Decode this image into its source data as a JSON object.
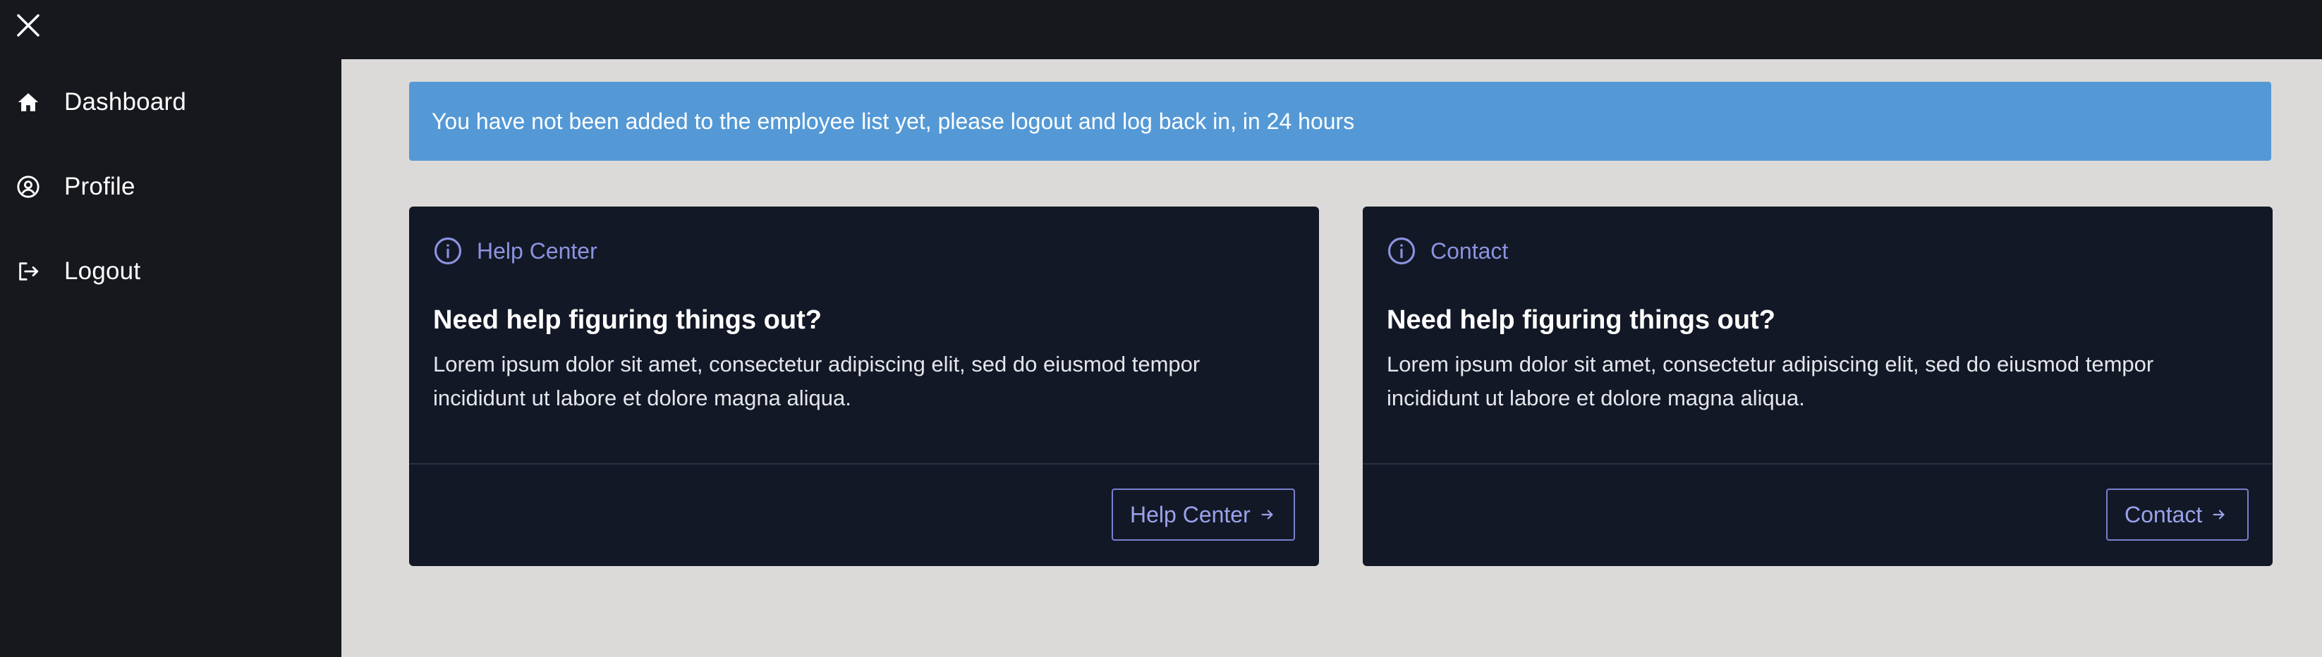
{
  "sidebar": {
    "items": [
      {
        "label": "Dashboard",
        "icon": "home-icon"
      },
      {
        "label": "Profile",
        "icon": "user-circle-icon"
      },
      {
        "label": "Logout",
        "icon": "logout-icon"
      }
    ]
  },
  "alert": {
    "text": "You have not been added to the employee list yet, please logout and log back in, in 24 hours",
    "color": "#5499d6"
  },
  "cards": [
    {
      "header": "Help Center",
      "title": "Need help figuring things out?",
      "body": "Lorem ipsum dolor sit amet, consectetur adipiscing elit, sed do eiusmod tempor incididunt ut labore et dolore magna aliqua.",
      "button_label": "Help Center",
      "icon": "info-icon"
    },
    {
      "header": "Contact",
      "title": "Need help figuring things out?",
      "body": "Lorem ipsum dolor sit amet, consectetur adipiscing elit, sed do eiusmod tempor incididunt ut labore et dolore magna aliqua.",
      "button_label": "Contact",
      "icon": "info-icon"
    }
  ],
  "colors": {
    "sidebar_bg": "#17181d",
    "main_bg": "#dcdad8",
    "card_bg": "#131826",
    "accent": "#8b93e0"
  }
}
